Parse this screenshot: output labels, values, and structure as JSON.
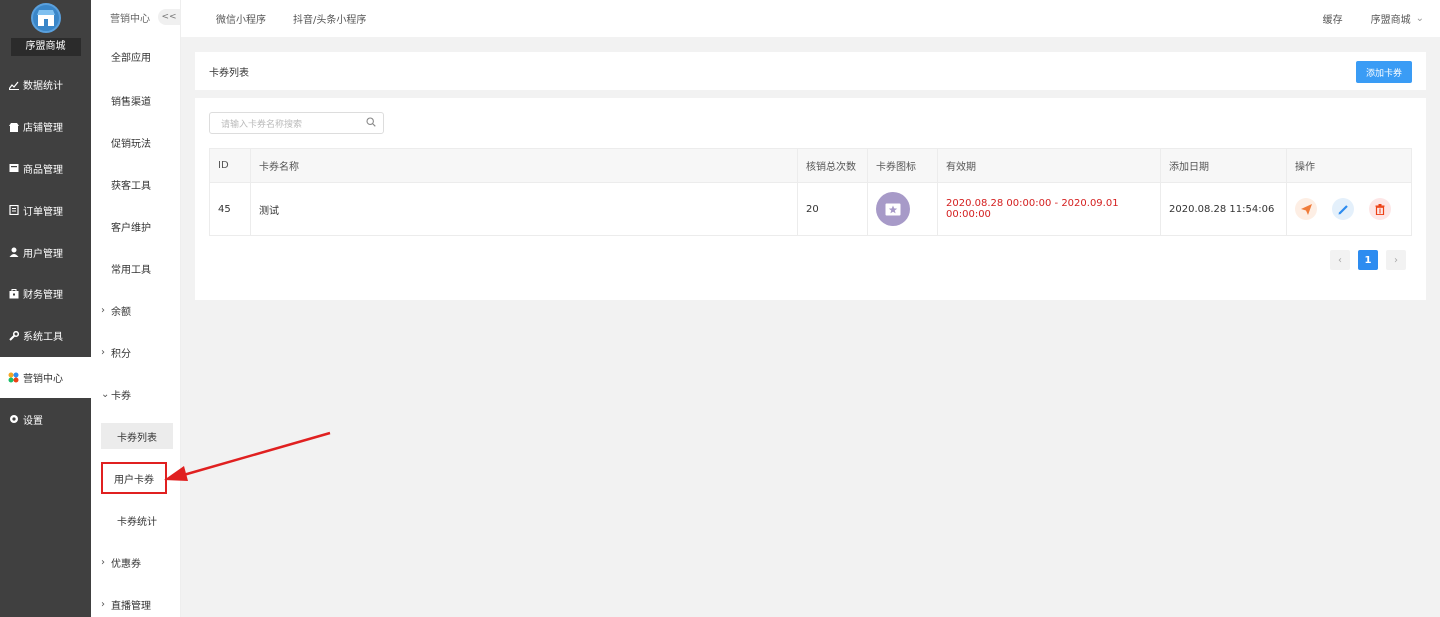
{
  "sidebar": {
    "shop_name": "序盟商城",
    "items": [
      {
        "label": "数据统计",
        "icon": "chart-icon"
      },
      {
        "label": "店铺管理",
        "icon": "store-icon"
      },
      {
        "label": "商品管理",
        "icon": "goods-icon"
      },
      {
        "label": "订单管理",
        "icon": "order-icon"
      },
      {
        "label": "用户管理",
        "icon": "user-icon"
      },
      {
        "label": "财务管理",
        "icon": "finance-icon"
      },
      {
        "label": "系统工具",
        "icon": "wrench-icon"
      },
      {
        "label": "营销中心",
        "icon": "marketing-icon"
      },
      {
        "label": "设置",
        "icon": "gear-icon"
      }
    ]
  },
  "submenu": {
    "title": "营销中心",
    "collapse": "<<",
    "items": [
      "全部应用",
      "销售渠道",
      "促销玩法",
      "获客工具",
      "客户维护",
      "常用工具"
    ],
    "groups": [
      {
        "label": "余额",
        "chevron": "›"
      },
      {
        "label": "积分",
        "chevron": "›"
      },
      {
        "label": "卡券",
        "chevron": "⌄"
      }
    ],
    "card_children": [
      "卡券列表",
      "用户卡券",
      "卡券统计"
    ],
    "groups_after": [
      {
        "label": "优惠券",
        "chevron": "›"
      },
      {
        "label": "直播管理",
        "chevron": "›"
      }
    ]
  },
  "topbar": {
    "tabs": [
      "微信小程序",
      "抖音/头条小程序"
    ],
    "cache": "缓存",
    "shop": "序盟商城",
    "shop_chevron": "⌄"
  },
  "panel": {
    "title": "卡券列表",
    "add_button": "添加卡券"
  },
  "search": {
    "placeholder": "请输入卡券名称搜索"
  },
  "table": {
    "headers": [
      "ID",
      "卡券名称",
      "核销总次数",
      "卡券图标",
      "有效期",
      "添加日期",
      "操作"
    ],
    "rows": [
      {
        "id": "45",
        "name": "测试",
        "count": "20",
        "validity": "2020.08.28 00:00:00 - 2020.09.01 00:00:00",
        "added": "2020.08.28 11:54:06"
      }
    ]
  },
  "pagination": {
    "prev": "‹",
    "current": "1",
    "next": "›"
  },
  "colors": {
    "sidebar_bg": "#404040",
    "primary": "#3a9cf5",
    "validity_text": "#d42020",
    "annotation": "#e02020"
  }
}
